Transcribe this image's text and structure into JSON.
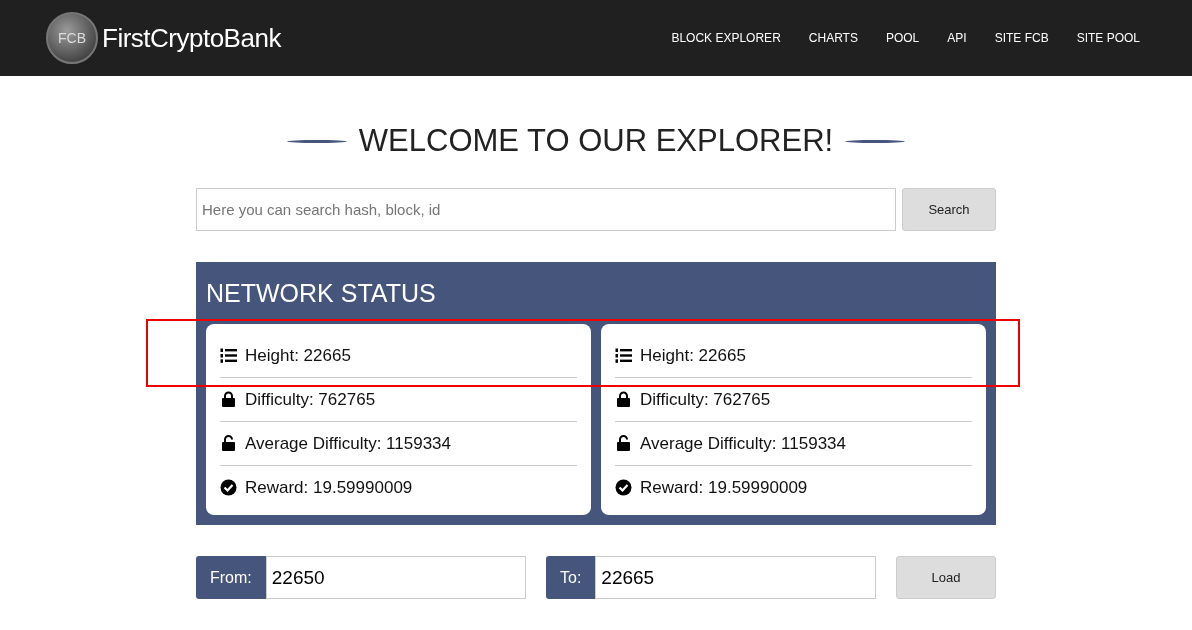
{
  "header": {
    "logo_badge": "FCB",
    "brand": "FirstCryptoBank",
    "nav": [
      {
        "label": "BLOCK EXPLORER"
      },
      {
        "label": "CHARTS"
      },
      {
        "label": "POOL"
      },
      {
        "label": "API"
      },
      {
        "label": "SITE FCB"
      },
      {
        "label": "SITE POOL"
      }
    ]
  },
  "title": "WELCOME TO OUR EXPLORER!",
  "search": {
    "placeholder": "Here you can search hash, block, id",
    "button": "Search"
  },
  "network_status": {
    "title": "NETWORK STATUS",
    "cards": [
      {
        "rows": [
          {
            "kind": "list",
            "text": "Height: 22665"
          },
          {
            "kind": "lock",
            "text": "Difficulty: 762765"
          },
          {
            "kind": "unlock",
            "text": "Average Difficulty: 1159334"
          },
          {
            "kind": "check",
            "text": "Reward: 19.59990009"
          }
        ]
      },
      {
        "rows": [
          {
            "kind": "list",
            "text": "Height: 22665"
          },
          {
            "kind": "lock",
            "text": "Difficulty: 762765"
          },
          {
            "kind": "unlock",
            "text": "Average Difficulty: 1159334"
          },
          {
            "kind": "check",
            "text": "Reward: 19.59990009"
          }
        ]
      }
    ]
  },
  "range": {
    "from_label": "From:",
    "from_value": "22650",
    "to_label": "To:",
    "to_value": "22665",
    "button": "Load"
  }
}
